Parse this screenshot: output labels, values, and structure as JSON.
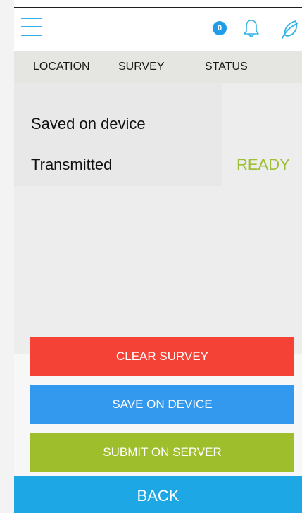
{
  "header": {
    "menu_icon": "menu-icon",
    "notification_count": "0",
    "bell_icon": "bell-icon",
    "leaf_icon": "leaf-icon",
    "accent_color": "#35b2e6",
    "badge_color": "#1e9ee8"
  },
  "tabs": [
    {
      "label": "LOCATION"
    },
    {
      "label": "SURVEY"
    },
    {
      "label": "STATUS"
    }
  ],
  "status": {
    "saved_label": "Saved on device",
    "transmitted_label": "Transmitted",
    "ready_label": "READY",
    "ready_color": "#9dbe35"
  },
  "buttons": {
    "clear": {
      "label": "CLEAR SURVEY",
      "color": "#f44336"
    },
    "save": {
      "label": "SAVE ON DEVICE",
      "color": "#3399ee"
    },
    "submit": {
      "label": "SUBMIT ON SERVER",
      "color": "#9fbe2b"
    },
    "back": {
      "label": "BACK",
      "color": "#1ea7e5"
    }
  }
}
